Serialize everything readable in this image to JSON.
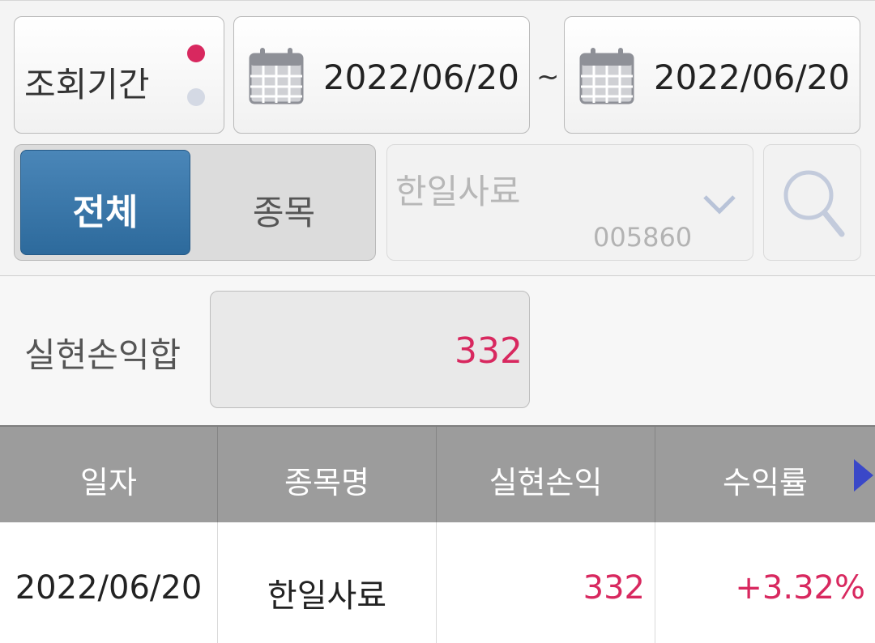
{
  "period": {
    "label": "조회기간"
  },
  "date_from": "2022/06/20",
  "separator": "~",
  "date_to": "2022/06/20",
  "toggle": {
    "all_label": "전체",
    "stock_label": "종목",
    "selected": "전체"
  },
  "stock": {
    "name": "한일사료",
    "code": "005860"
  },
  "summary": {
    "label": "실현손익합",
    "value": "332"
  },
  "table": {
    "columns": [
      "일자",
      "종목명",
      "실현손익",
      "수익률"
    ],
    "rows": [
      {
        "date": "2022/06/20",
        "name": "한일사료",
        "profit": "332",
        "rate": "+3.32%"
      }
    ]
  },
  "colors": {
    "accent": "#d8285f",
    "selected_toggle": "#3a78ab",
    "header_bg": "#9c9c9c"
  },
  "icons": [
    "calendar-icon",
    "chevron-down-icon",
    "search-icon",
    "scroll-right-arrow-icon"
  ]
}
